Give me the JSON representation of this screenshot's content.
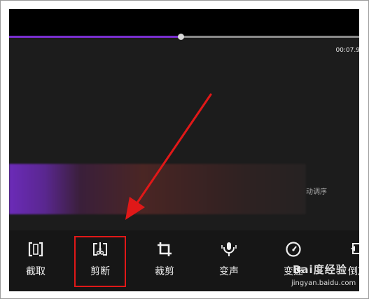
{
  "player": {
    "time_display": "00:07.9/",
    "progress_fraction": 0.49,
    "progress_color": "#7a2fd0"
  },
  "clip_strip": {
    "hint_text": "动调序"
  },
  "toolbar": {
    "tools": [
      {
        "label": "截取",
        "icon": "trim-bracket-icon"
      },
      {
        "label": "剪断",
        "icon": "cut-scissors-icon"
      },
      {
        "label": "裁剪",
        "icon": "crop-icon"
      },
      {
        "label": "变声",
        "icon": "microphone-icon"
      },
      {
        "label": "变速",
        "icon": "speedometer-icon"
      },
      {
        "label": "倒放",
        "icon": "reverse-icon"
      }
    ],
    "highlighted_tool": "剪断",
    "highlight_color": "#e01818"
  },
  "watermark": {
    "logo_text": "Bai度经验",
    "url": "jingyan.baidu.com"
  }
}
